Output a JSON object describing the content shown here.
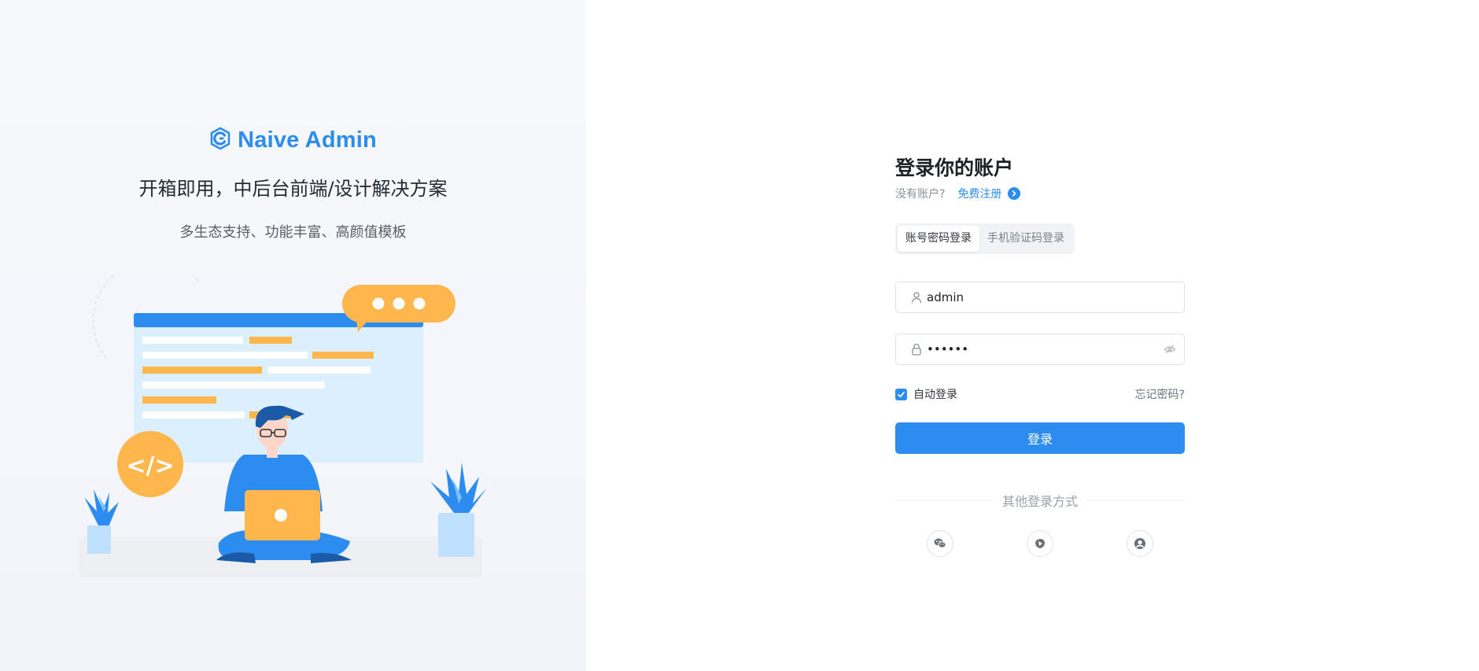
{
  "brand": {
    "title": "Naive Admin",
    "logo_icon": "hexagon-logo-icon"
  },
  "hero": {
    "slogan": "开箱即用，中后台前端/设计解决方案",
    "subslogan": "多生态支持、功能丰富、高颜值模板"
  },
  "login": {
    "heading": "登录你的账户",
    "no_account": "没有账户?",
    "signup_link": "免费注册",
    "tabs": [
      {
        "label": "账号密码登录",
        "active": true
      },
      {
        "label": "手机验证码登录",
        "active": false
      }
    ],
    "username": {
      "value": "admin",
      "icon": "user-icon"
    },
    "password": {
      "value": "••••••",
      "icon": "lock-icon",
      "toggle_icon": "eye-off-icon"
    },
    "remember": {
      "label": "自动登录",
      "checked": true
    },
    "forgot": "忘记密码?",
    "submit_label": "登录",
    "other_methods_label": "其他登录方式",
    "socials": [
      {
        "icon": "wechat-icon"
      },
      {
        "icon": "weibo-icon"
      },
      {
        "icon": "qq-icon"
      }
    ]
  },
  "colors": {
    "primary": "#2d8cf0",
    "accent": "#ffb74d",
    "panel": "#f4f6fb"
  }
}
